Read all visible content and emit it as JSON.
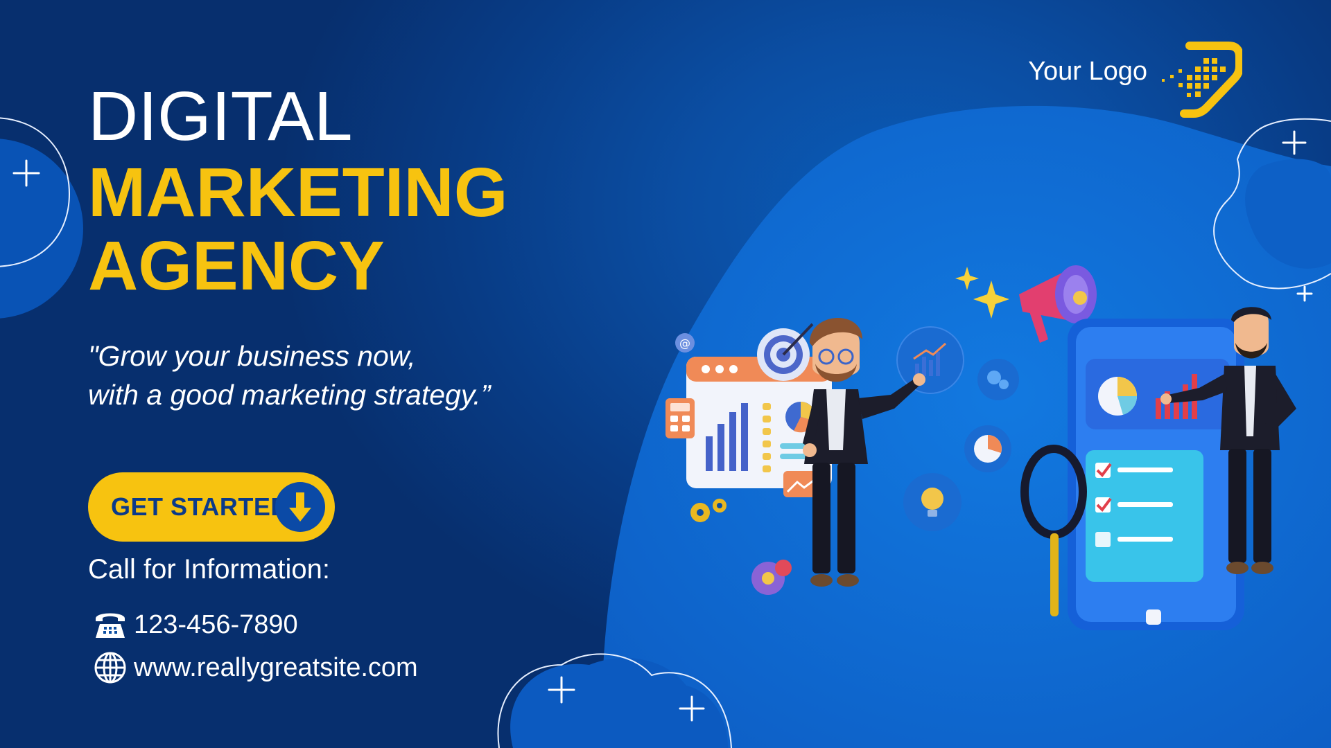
{
  "logo": {
    "text": "Your Logo",
    "icon": "logo-icon"
  },
  "headline": {
    "line1": "DIGITAL",
    "line2": "MARKETING",
    "line3": "AGENCY"
  },
  "tagline": {
    "line1": "\"Grow your business now,",
    "line2": "with a good marketing strategy.”"
  },
  "cta": {
    "label": "GET STARTED",
    "icon": "arrow-down-icon"
  },
  "contact": {
    "heading": "Call for Information:",
    "phone": "123-456-7890",
    "phone_icon": "telephone-icon",
    "website": "www.reallygreatsite.com",
    "website_icon": "globe-icon"
  },
  "colors": {
    "accent": "#f7c310",
    "background": "#0b4ea3",
    "text": "#ffffff"
  }
}
